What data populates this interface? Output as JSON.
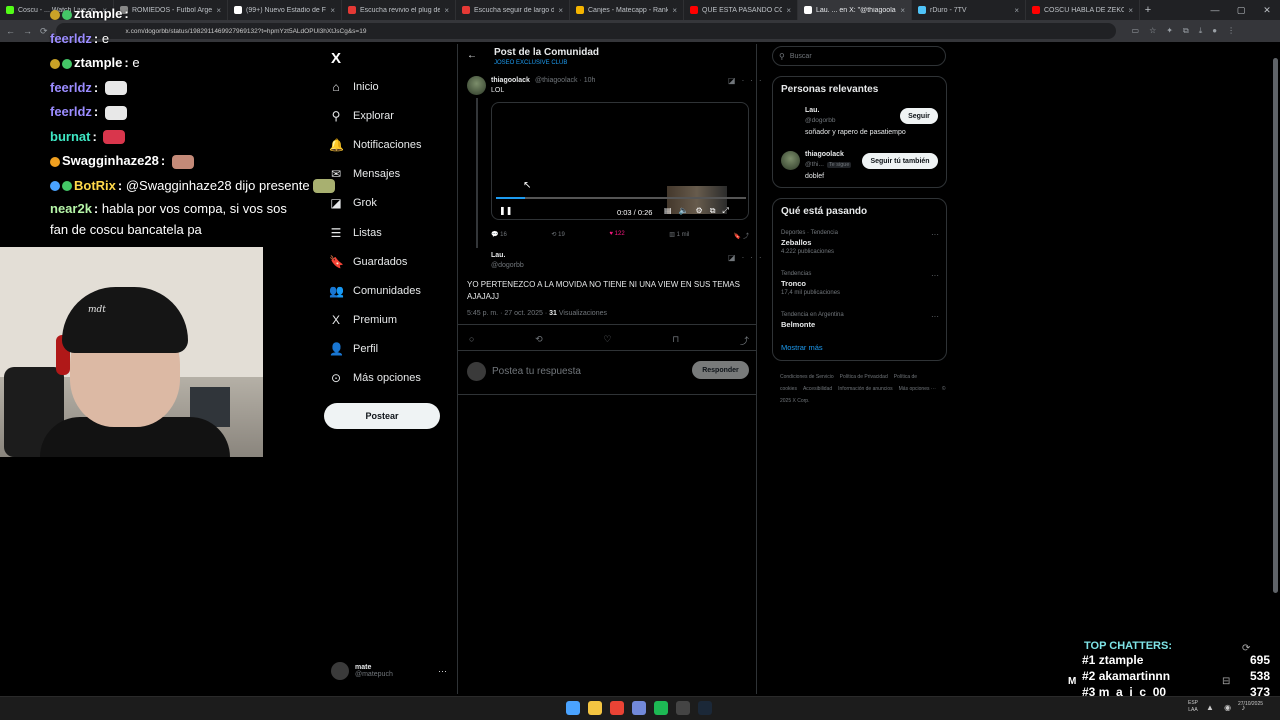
{
  "browser": {
    "tabs": [
      {
        "title": "Coscu - ... Watch Live on ...",
        "color": "#53fc18",
        "active": false
      },
      {
        "title": "ROMIEDOS - Futbol Argentino",
        "color": "#888888",
        "active": false
      },
      {
        "title": "(99+) Nuevo Estadio de Fútbol",
        "color": "#ffffff",
        "active": false
      },
      {
        "title": "Escucha revivio el plug de To...",
        "color": "#e53935",
        "active": false
      },
      {
        "title": "Escucha seguir de largo de K...",
        "color": "#e53935",
        "active": false
      },
      {
        "title": "Canjes - Matecapp - Ranking",
        "color": "#f4b400",
        "active": false
      },
      {
        "title": "QUE ESTA PASANDO CON EL...",
        "color": "#ff0000",
        "active": false
      },
      {
        "title": "Lau. ... en X: \"@thiagoolack",
        "color": "#ffffff",
        "active": true
      },
      {
        "title": "rDuro - 7TV",
        "color": "#4fc3f7",
        "active": false
      },
      {
        "title": "COSCU HABLA DE ZEKO Y SU...",
        "color": "#ff0000",
        "active": false
      }
    ],
    "url": "x.com/dogorbb/status/1982911469927969132?t=hpmYzt5ALdOPUl3hXtJsCg&s=19"
  },
  "stream_chat": [
    {
      "user": "ztample",
      "color": "#ffffff",
      "text": "",
      "badges": [
        "#c9a227",
        "#44c767"
      ],
      "emote": ""
    },
    {
      "user": "feerldz",
      "color": "#9b8cff",
      "text": "e",
      "badges": [],
      "emote": ""
    },
    {
      "user": "ztample",
      "color": "#ffffff",
      "text": "e",
      "badges": [
        "#c9a227",
        "#44c767"
      ],
      "emote": ""
    },
    {
      "user": "feerldz",
      "color": "#9b8cff",
      "text": "",
      "badges": [],
      "emote": "#e8e8e8"
    },
    {
      "user": "feerldz",
      "color": "#9b8cff",
      "text": "",
      "badges": [],
      "emote": "#e8e8e8"
    },
    {
      "user": "burnat",
      "color": "#3fe8c4",
      "text": "",
      "badges": [],
      "emote": "#d9364c"
    },
    {
      "user": "Swagginhaze28",
      "color": "#ffffff",
      "text": "",
      "badges": [
        "#f0a020"
      ],
      "emote": "#c48a78"
    },
    {
      "user": "BotRix",
      "color": "#ffd94a",
      "text": "@Swagginhaze28 dijo presente",
      "badges": [
        "#4aa3ff",
        "#44c767"
      ],
      "emote": "#a8b070"
    },
    {
      "user": "near2k",
      "color": "#b6f5a8",
      "text": "habla por vos compa, si vos sos fan de coscu bancatela pa",
      "badges": [],
      "emote": ""
    }
  ],
  "webcam": {
    "beanie_text": "mdt"
  },
  "x_nav": {
    "logo": "X",
    "items": [
      {
        "label": "Inicio",
        "icon": "home-icon",
        "glyph": "⌂"
      },
      {
        "label": "Explorar",
        "icon": "search-icon",
        "glyph": "⚲"
      },
      {
        "label": "Notificaciones",
        "icon": "bell-icon",
        "glyph": "🔔"
      },
      {
        "label": "Mensajes",
        "icon": "mail-icon",
        "glyph": "✉"
      },
      {
        "label": "Grok",
        "icon": "grok-icon",
        "glyph": "◪"
      },
      {
        "label": "Listas",
        "icon": "list-icon",
        "glyph": "☰"
      },
      {
        "label": "Guardados",
        "icon": "bookmark-icon",
        "glyph": "🔖"
      },
      {
        "label": "Comunidades",
        "icon": "people-icon",
        "glyph": "👥"
      },
      {
        "label": "Premium",
        "icon": "x-icon",
        "glyph": "X"
      },
      {
        "label": "Perfil",
        "icon": "person-icon",
        "glyph": "👤"
      },
      {
        "label": "Más opciones",
        "icon": "more-circle-icon",
        "glyph": "⊙"
      }
    ],
    "post_label": "Postear",
    "account": {
      "name": "mate",
      "handle": "@matepuch"
    }
  },
  "main": {
    "title": "Post de la Comunidad",
    "subtitle": "JOSEO EXCLUSIVE CLUB",
    "post1": {
      "name": "thiagoolack",
      "handle": "@thiagoolack",
      "time": "10h",
      "text": "LOL",
      "video_time": "0:03 / 0:26",
      "video_progress": 0.115,
      "replies": "16",
      "reposts": "19",
      "likes": "122",
      "views": "1 mil"
    },
    "post2": {
      "name": "Lau.",
      "handle": "@dogorbb",
      "text": "YO PERTENEZCO A LA MOVIDA NO TIENE NI UNA VIEW EN SUS TEMAS AJAJAJJ",
      "timestamp": "5:45 p. m. · 27 oct. 2025 ·",
      "views_count": "31",
      "views_label": "Visualizaciones"
    },
    "reply": {
      "placeholder": "Postea tu respuesta",
      "button": "Responder"
    }
  },
  "right": {
    "search_placeholder": "Buscar",
    "relevant": {
      "title": "Personas relevantes",
      "people": [
        {
          "name": "Lau.",
          "handle": "@dogorbb",
          "bio": "soñador y rapero de pasatiempo",
          "button": "Seguir",
          "follows_you": ""
        },
        {
          "name": "thiagoolack",
          "handle": "@thi...",
          "bio": "doblef",
          "button": "Seguir tú también",
          "follows_you": "Te sigue"
        }
      ]
    },
    "trending": {
      "title": "Qué está pasando",
      "items": [
        {
          "category": "Deportes · Tendencia",
          "name": "Zeballos",
          "count": "4.222 publicaciones"
        },
        {
          "category": "Tendencias",
          "name": "Tronco",
          "count": "17,4 mil publicaciones"
        },
        {
          "category": "Tendencia en Argentina",
          "name": "Belmonte",
          "count": ""
        }
      ],
      "show_more": "Mostrar más"
    },
    "footer": [
      "Condiciones de Servicio",
      "Política de Privacidad",
      "Política de cookies",
      "Accesibilidad",
      "Información de anuncios",
      "Más opciones ···",
      "© 2025 X Corp."
    ]
  },
  "top_chatters": {
    "title": "TOP CHATTERS:",
    "rows": [
      {
        "rank": "#1",
        "name": "ztample",
        "count": "695"
      },
      {
        "rank": "#2",
        "name": "akamartinnn",
        "count": "538"
      },
      {
        "rank": "#3",
        "name": "m_a_i_c_00",
        "count": "373"
      }
    ],
    "partial_label": "M"
  },
  "taskbar": {
    "icons": [
      {
        "name": "windows-start-icon",
        "color": "#4aa3ff"
      },
      {
        "name": "file-explorer-icon",
        "color": "#f4c542"
      },
      {
        "name": "chrome-icon",
        "color": "#ea4335"
      },
      {
        "name": "discord-icon",
        "color": "#7289da"
      },
      {
        "name": "spotify-icon",
        "color": "#1db954"
      },
      {
        "name": "obs-icon",
        "color": "#444444"
      },
      {
        "name": "steam-icon",
        "color": "#1b2838"
      }
    ],
    "lang": "ESP",
    "lang2": "LAA",
    "date": "27/10/2025"
  }
}
